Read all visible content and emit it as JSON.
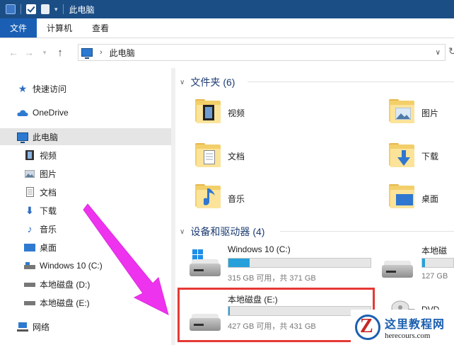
{
  "window": {
    "title": "此电脑"
  },
  "ribbon": {
    "tabs": [
      "文件",
      "计算机",
      "查看"
    ],
    "active_tab": "文件"
  },
  "address_bar": {
    "path": "此电脑"
  },
  "nav": [
    {
      "label": "快速访问",
      "icon": "star-icon"
    },
    {
      "label": "OneDrive",
      "icon": "cloud-icon"
    },
    {
      "label": "此电脑",
      "icon": "computer-icon",
      "selected": true
    },
    {
      "label": "视频",
      "icon": "video-icon"
    },
    {
      "label": "图片",
      "icon": "picture-icon"
    },
    {
      "label": "文档",
      "icon": "document-icon"
    },
    {
      "label": "下载",
      "icon": "download-icon"
    },
    {
      "label": "音乐",
      "icon": "music-icon"
    },
    {
      "label": "桌面",
      "icon": "desktop-icon"
    },
    {
      "label": "Windows 10 (C:)",
      "icon": "system-drive-icon"
    },
    {
      "label": "本地磁盘 (D:)",
      "icon": "drive-icon"
    },
    {
      "label": "本地磁盘 (E:)",
      "icon": "drive-icon"
    },
    {
      "label": "网络",
      "icon": "network-icon"
    }
  ],
  "folders_group": {
    "title": "文件夹",
    "count": "(6)",
    "items": [
      {
        "label": "视频",
        "icon": "video-folder-icon"
      },
      {
        "label": "图片",
        "icon": "picture-folder-icon"
      },
      {
        "label": "文档",
        "icon": "document-folder-icon"
      },
      {
        "label": "下载",
        "icon": "download-folder-icon"
      },
      {
        "label": "音乐",
        "icon": "music-folder-icon"
      },
      {
        "label": "桌面",
        "icon": "desktop-folder-icon"
      }
    ]
  },
  "drives_group": {
    "title": "设备和驱动器",
    "count": "(4)",
    "items": [
      {
        "name": "Windows 10 (C:)",
        "free_text": "315 GB 可用，共 371 GB",
        "used_fraction": 0.15,
        "icon": "system-drive-icon"
      },
      {
        "name": "本地磁盘 (E:)",
        "free_text": "427 GB 可用，共 431 GB",
        "used_fraction": 0.01,
        "icon": "drive-icon",
        "highlighted": true
      },
      {
        "name": "本地磁盘",
        "free_text": "127 GB",
        "used_fraction": 0.1,
        "icon": "drive-icon"
      },
      {
        "name": "DVD RW",
        "free_text": "",
        "icon": "dvd-drive-icon"
      }
    ]
  },
  "annotation": {
    "arrow_color": "#ee33ee",
    "highlight_color": "#e53935"
  },
  "watermark": {
    "site_cn": "这里教程网",
    "url": "herecours.com"
  }
}
